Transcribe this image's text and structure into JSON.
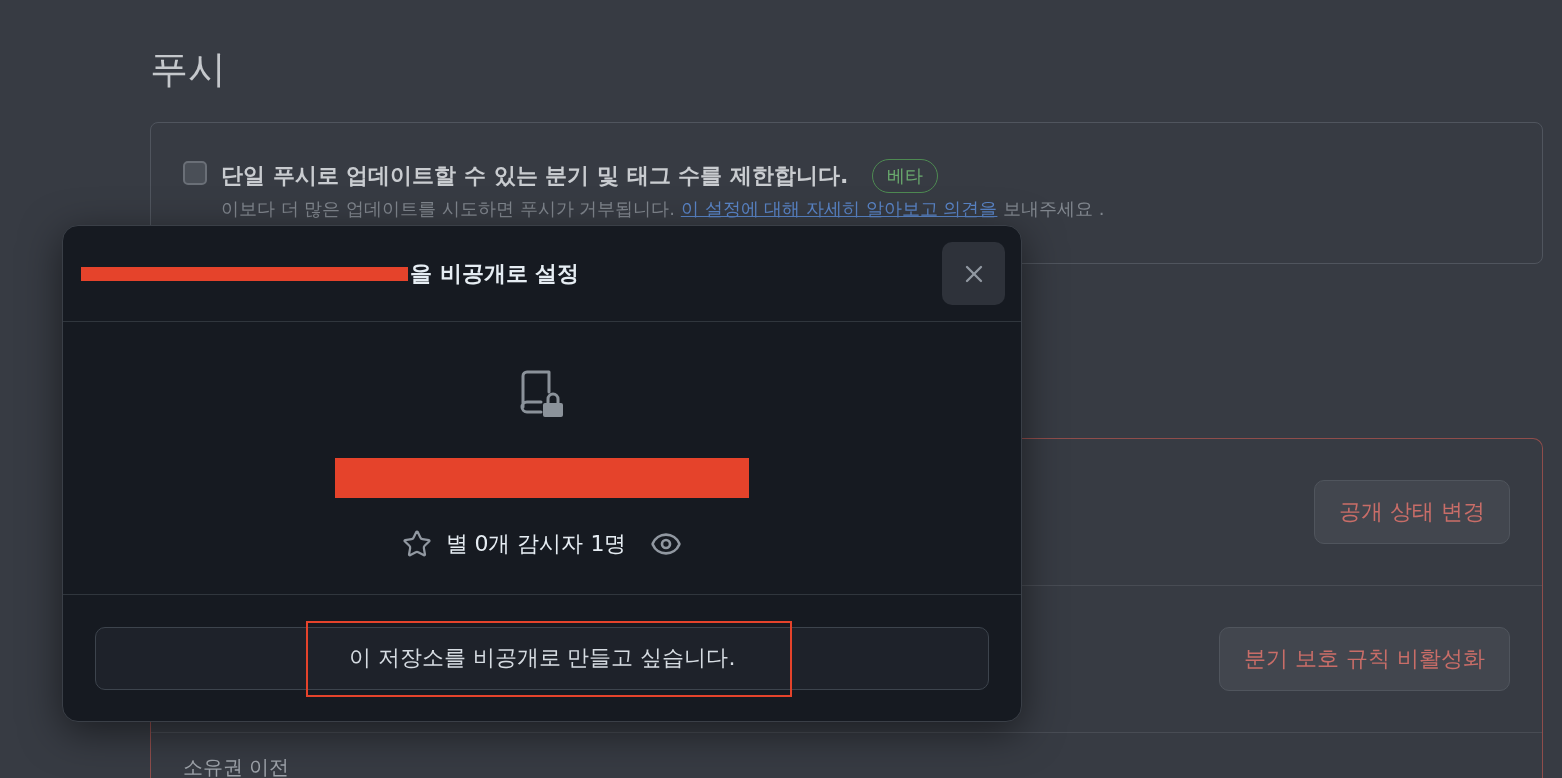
{
  "page": {
    "title": "푸시"
  },
  "push_setting": {
    "checked": false,
    "label": "단일 푸시로 업데이트할 수 있는 분기 및 태그 수를 제한합니다.",
    "badge": "베타",
    "description": "이보다 더 많은 업데이트를 시도하면 푸시가 거부됩니다.",
    "link": "이 설정에 대해 자세히 알아보고 의견을",
    "after": "보내주세요 ."
  },
  "danger_zone": {
    "rows": [
      {
        "kind": "button",
        "button": "공개 상태 변경"
      },
      {
        "kind": "button",
        "button": "분기 보호 규칙 비활성화"
      },
      {
        "kind": "title",
        "title": "소유권 이전"
      }
    ]
  },
  "dialog": {
    "title": "을 비공개로 설정",
    "stats": "별 0개 감시자 1명",
    "confirm_button": "이 저장소를 비공개로 만들고 싶습니다."
  }
}
